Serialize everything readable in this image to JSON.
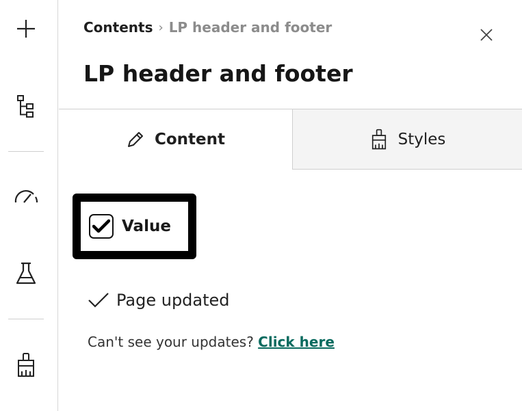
{
  "rail": {
    "items": [
      {
        "icon": "plus-icon"
      },
      {
        "icon": "tree-structure-icon"
      },
      {
        "icon": "speedometer-icon"
      },
      {
        "icon": "flask-icon"
      },
      {
        "icon": "brush-icon"
      }
    ]
  },
  "panel": {
    "breadcrumb": {
      "root": "Contents",
      "separator": "›",
      "current": "LP header and footer"
    },
    "title": "LP header and footer",
    "tabs": [
      {
        "label": "Content",
        "icon": "pencil-icon",
        "active": true
      },
      {
        "label": "Styles",
        "icon": "brush-icon",
        "active": false
      }
    ],
    "value_checkbox": {
      "label": "Value",
      "checked": true
    },
    "status": {
      "text": "Page updated"
    },
    "updates": {
      "prompt": "Can't see your updates?",
      "link": "Click here"
    }
  },
  "colors": {
    "link": "#0a6b5f",
    "muted": "#8c8c8c",
    "tab_inactive_bg": "#f4f4f4"
  }
}
